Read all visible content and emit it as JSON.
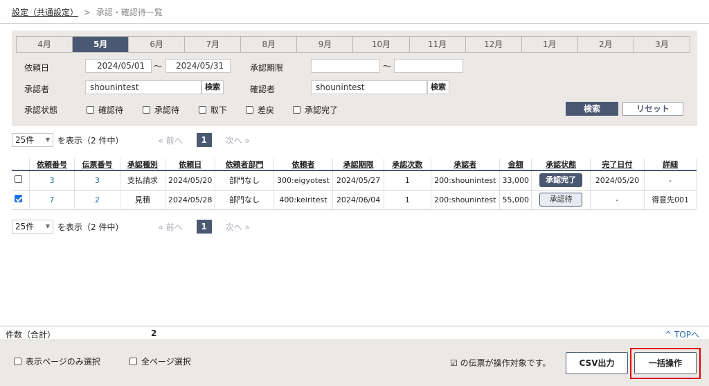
{
  "breadcrumb": {
    "parent": "設定（共通設定）",
    "separator": ">",
    "current": "承認・確認待一覧"
  },
  "months": [
    "4月",
    "5月",
    "6月",
    "7月",
    "8月",
    "9月",
    "10月",
    "11月",
    "12月",
    "1月",
    "2月",
    "3月"
  ],
  "active_month": "5月",
  "search": {
    "request_date_label": "依頼日",
    "request_date_from": "2024/05/01",
    "request_date_to": "2024/05/31",
    "tilde": "〜",
    "deadline_label": "承認期限",
    "deadline_from": "",
    "deadline_to": "",
    "approver_label": "承認者",
    "approver_value": "shounintest",
    "confirmer_label": "確認者",
    "confirmer_value": "shounintest",
    "lookup_label": "検索",
    "status_label": "承認状態",
    "statuses": [
      "確認待",
      "承認待",
      "取下",
      "差戻",
      "承認完了"
    ],
    "search_button": "検索",
    "reset_button": "リセット"
  },
  "pager": {
    "per_page": "25件",
    "count_text": "を表示（2 件中）",
    "prev": "« 前へ",
    "page": "1",
    "next": "次へ »"
  },
  "table": {
    "headers": [
      "依頼番号",
      "伝票番号",
      "承認種別",
      "依頼日",
      "依頼者部門",
      "依頼者",
      "承認期限",
      "承認次数",
      "承認者",
      "金額",
      "承認状態",
      "完了日付",
      "詳細"
    ],
    "rows": [
      {
        "checked": false,
        "request_no": "3",
        "slip_no": "3",
        "type": "支払請求",
        "request_date": "2024/05/20",
        "dept": "部門なし",
        "requester": "300:eigyotest",
        "deadline": "2024/05/27",
        "level": "1",
        "approver": "200:shounintest",
        "amount": "33,000",
        "status": "承認完了",
        "completed": "2024/05/20",
        "detail": "-"
      },
      {
        "checked": true,
        "request_no": "7",
        "slip_no": "2",
        "type": "見積",
        "request_date": "2024/05/28",
        "dept": "部門なし",
        "requester": "400:keiritest",
        "deadline": "2024/06/04",
        "level": "1",
        "approver": "200:shounintest",
        "amount": "55,000",
        "status": "承認待",
        "completed": "-",
        "detail": "得意先001"
      }
    ]
  },
  "totals": {
    "label": "件数（合計）",
    "value": "2",
    "top_link": "^ TOPへ"
  },
  "footer": {
    "select_page_label": "表示ページのみ選択",
    "select_all_label": "全ページ選択",
    "note": "☑ の伝票が操作対象です。",
    "csv_button": "CSV出力",
    "bulk_button": "一括操作"
  }
}
